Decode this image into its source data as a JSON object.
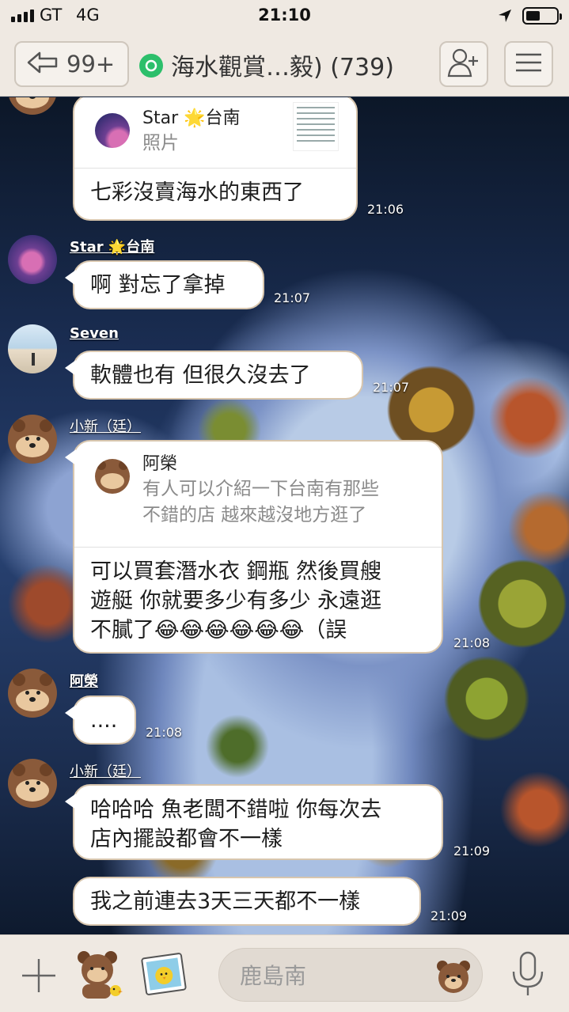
{
  "status_bar": {
    "carrier": "GT",
    "network": "4G",
    "time": "21:10",
    "battery_level": 0.45
  },
  "header": {
    "unread_count": "99+",
    "group_title": "海水觀賞…毅) (739)"
  },
  "messages": [
    {
      "sender": "",
      "avatar": "bear",
      "reply": {
        "name": "Star 🌟台南",
        "quote": "照片"
      },
      "lines": [
        "七彩沒賣海水的東西了"
      ],
      "time": "21:06"
    },
    {
      "sender": "Star 🌟台南",
      "avatar": "star",
      "lines": [
        "啊 對忘了拿掉"
      ],
      "time": "21:07"
    },
    {
      "sender": "Seven",
      "avatar": "seven",
      "lines": [
        "軟體也有 但很久沒去了"
      ],
      "time": "21:07"
    },
    {
      "sender": "小新（廷）",
      "avatar": "bear",
      "reply": {
        "name": "阿榮",
        "quote_lines": [
          "有人可以介紹一下台南有那些",
          "不錯的店 越來越沒地方逛了"
        ]
      },
      "lines": [
        "可以買套潛水衣 鋼瓶 然後買艘",
        "遊艇 你就要多少有多少 永遠逛",
        "不膩了😂😂😂😂😂😂（誤"
      ],
      "time": "21:08"
    },
    {
      "sender": "阿榮",
      "avatar": "bear",
      "lines": [
        "...."
      ],
      "time": "21:08"
    },
    {
      "sender": "小新（廷）",
      "avatar": "bear",
      "lines": [
        "哈哈哈 魚老闆不錯啦 你每次去",
        "店內擺設都會不一樣"
      ],
      "time": "21:09"
    },
    {
      "sender": "",
      "avatar": "",
      "lines": [
        "我之前連去3天三天都不一樣"
      ],
      "time": "21:09"
    }
  ],
  "input": {
    "placeholder": "鹿島南"
  },
  "icons": {
    "back": "arrow-left-icon",
    "group": "group-chat-icon",
    "add_friend": "add-person-icon",
    "menu": "hamburger-menu-icon",
    "plus": "plus-icon",
    "sticker": "sticker-icon",
    "photo": "photo-icon",
    "emoji": "emoji-icon",
    "mic": "microphone-icon"
  },
  "colors": {
    "bar_background": "#efe9e2",
    "bubble": "#ffffff",
    "group_badge": "#2cbf6b"
  }
}
